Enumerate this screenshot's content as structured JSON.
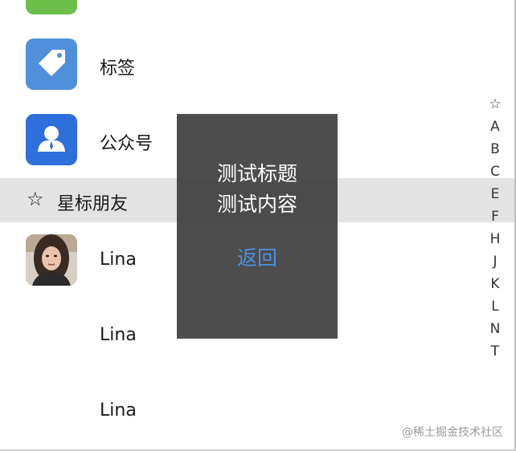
{
  "contacts": {
    "tags_label": "标签",
    "public_label": "公众号",
    "starred_section": "星标朋友",
    "starred_icon": "☆",
    "friends": [
      "Lina",
      "Lina",
      "Lina"
    ]
  },
  "index_bar": [
    "☆",
    "A",
    "B",
    "C",
    "E",
    "F",
    "H",
    "J",
    "K",
    "L",
    "N",
    "T"
  ],
  "dialog": {
    "title": "测试标题",
    "content": "测试内容",
    "back_label": "返回"
  },
  "watermark": "@稀土掘金技术社区",
  "icons": {
    "tags": "tag-icon",
    "public": "person-icon",
    "star": "star-outline-icon"
  },
  "colors": {
    "tag_icon_bg": "#4f8fdb",
    "public_icon_bg": "#2f6fdc",
    "partial_icon_bg": "#6cc04a",
    "section_bg": "#e3e3e3",
    "dialog_bg": "#404040",
    "dialog_button": "#4a90e2"
  }
}
